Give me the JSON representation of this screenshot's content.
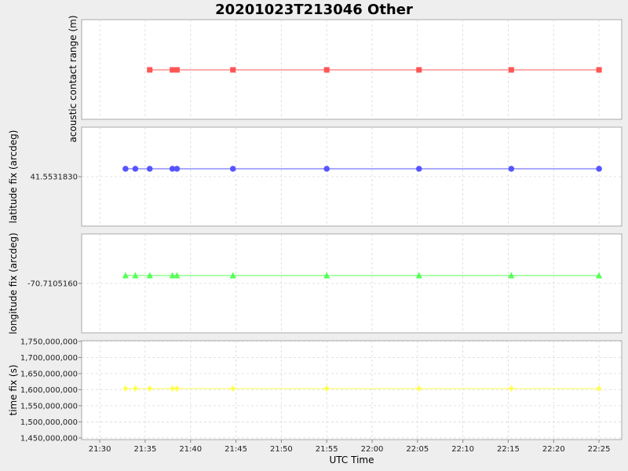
{
  "chart_data": {
    "title": "20201023T213046 Other",
    "type": "line",
    "xlabel": "UTC Time",
    "x_ticks": [
      "21:30",
      "21:35",
      "21:40",
      "21:45",
      "21:50",
      "21:55",
      "22:00",
      "22:05",
      "22:10",
      "22:15",
      "22:20",
      "22:25"
    ],
    "xlim": [
      "21:28:00",
      "22:27:30"
    ],
    "grid": true,
    "panels": [
      {
        "ylabel": "acoustic contact range (m)",
        "color": "#ff5555",
        "marker": "square",
        "y_ticks": [],
        "x": [
          "21:35:30",
          "21:38:00",
          "21:38:30",
          "21:44:40",
          "21:55:00",
          "22:05:10",
          "22:15:20",
          "22:25:00"
        ],
        "y": [
          null,
          null,
          null,
          null,
          null,
          null,
          null,
          null
        ]
      },
      {
        "ylabel": "latitude fix (arcdeg)",
        "color": "#5555ff",
        "marker": "circle",
        "y_ticks": [
          "41.5531830"
        ],
        "x": [
          "21:32:50",
          "21:33:55",
          "21:35:30",
          "21:38:00",
          "21:38:30",
          "21:44:40",
          "21:55:00",
          "22:05:10",
          "22:15:20",
          "22:25:00"
        ],
        "y": [
          41.553183,
          41.553183,
          41.553183,
          41.553183,
          41.553183,
          41.553183,
          41.553183,
          41.553183,
          41.553183,
          41.553183
        ]
      },
      {
        "ylabel": "longitude fix (arcdeg)",
        "color": "#55ff55",
        "marker": "triangle",
        "y_ticks": [
          "-70.7105160"
        ],
        "x": [
          "21:32:50",
          "21:33:55",
          "21:35:30",
          "21:38:00",
          "21:38:30",
          "21:44:40",
          "21:55:00",
          "22:05:10",
          "22:15:20",
          "22:25:00"
        ],
        "y": [
          -70.710516,
          -70.710516,
          -70.710516,
          -70.710516,
          -70.710516,
          -70.710516,
          -70.710516,
          -70.710516,
          -70.710516,
          -70.710516
        ]
      },
      {
        "ylabel": "time fix (s)",
        "color": "#ffff55",
        "marker": "diamond",
        "y_ticks": [
          "1,450,000,000",
          "1,500,000,000",
          "1,550,000,000",
          "1,600,000,000",
          "1,650,000,000",
          "1,700,000,000",
          "1,750,000,000"
        ],
        "ylim": [
          1445000000,
          1752000000
        ],
        "x": [
          "21:32:50",
          "21:33:55",
          "21:35:30",
          "21:38:00",
          "21:38:30",
          "21:44:40",
          "21:55:00",
          "22:05:10",
          "22:15:20",
          "22:25:00"
        ],
        "y": [
          1603488770,
          1603488835,
          1603488930,
          1603489080,
          1603489110,
          1603489480,
          1603490100,
          1603490710,
          1603491320,
          1603491900
        ]
      }
    ]
  }
}
